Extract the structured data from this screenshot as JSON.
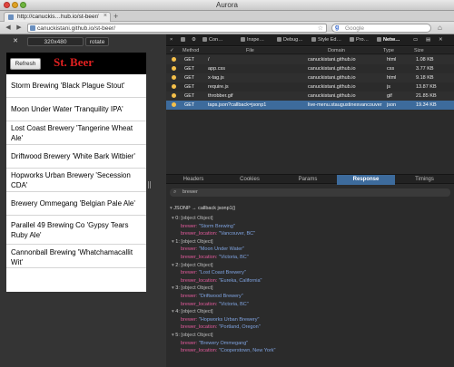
{
  "window": {
    "title": "Aurora"
  },
  "tabs": [
    {
      "label": "http://canuckis…hub.io/st-beer/"
    }
  ],
  "nav": {
    "url": "canuckistani.github.io/st-beer/",
    "search_placeholder": "Google"
  },
  "responsive": {
    "close": "✕",
    "size": "320x480",
    "rotate": "rotate"
  },
  "app": {
    "refresh_label": "Refresh",
    "title": "St. Beer",
    "beers": [
      "Storm Brewing 'Black Plague Stout'",
      "Moon Under Water 'Tranquility IPA'",
      "Lost Coast Brewery 'Tangerine Wheat Ale'",
      "Driftwood Brewery 'White Bark Witbier'",
      "Hopworks Urban Brewery 'Secession CDA'",
      "Brewery Ommegang 'Belgian Pale Ale'",
      "Parallel 49 Brewing Co 'Gypsy Tears Ruby Ale'",
      "Cannonball Brewing 'Whatchamacallit Wit'"
    ]
  },
  "devtools": {
    "tools": [
      "Con…",
      "Inspe…",
      "Debug…",
      "Style Ed…",
      "Pro…",
      "Netw…"
    ],
    "columns": {
      "method": "Method",
      "file": "File",
      "domain": "Domain",
      "type": "Type",
      "size": "Size"
    },
    "requests": [
      {
        "method": "GET",
        "file": "/",
        "domain": "canuckistani.github.io",
        "type": "html",
        "size": "1.08 KB"
      },
      {
        "method": "GET",
        "file": "app.css",
        "domain": "canuckistani.github.io",
        "type": "css",
        "size": "3.77 KB"
      },
      {
        "method": "GET",
        "file": "x-tag.js",
        "domain": "canuckistani.github.io",
        "type": "html",
        "size": "9.18 KB"
      },
      {
        "method": "GET",
        "file": "require.js",
        "domain": "canuckistani.github.io",
        "type": "js",
        "size": "13.87 KB"
      },
      {
        "method": "GET",
        "file": "throbber.gif",
        "domain": "canuckistani.github.io",
        "type": "gif",
        "size": "21.85 KB"
      },
      {
        "method": "GET",
        "file": "taps.json?callback=jsonp1",
        "domain": "live-menu.staugustinesvancouver…",
        "type": "json",
        "size": "19.34 KB"
      }
    ],
    "detail_tabs": [
      "Headers",
      "Cookies",
      "Params",
      "Response",
      "Timings"
    ],
    "active_detail_tab": "Response",
    "filter_value": "brewer",
    "json_header": "JSONP → callback jsonp1()",
    "json_rows": [
      {
        "kind": "obj",
        "index": "0:",
        "label": "[object Object]"
      },
      {
        "kind": "prop",
        "key": "brewer:",
        "value": "\"Storm Brewing\""
      },
      {
        "kind": "prop",
        "key": "brewer_location:",
        "value": "\"Vancouver, BC\""
      },
      {
        "kind": "obj",
        "index": "1:",
        "label": "[object Object]"
      },
      {
        "kind": "prop",
        "key": "brewer:",
        "value": "\"Moon Under Water\""
      },
      {
        "kind": "prop",
        "key": "brewer_location:",
        "value": "\"Victoria, BC\""
      },
      {
        "kind": "obj",
        "index": "2:",
        "label": "[object Object]"
      },
      {
        "kind": "prop",
        "key": "brewer:",
        "value": "\"Lost Coast Brewery\""
      },
      {
        "kind": "prop",
        "key": "brewer_location:",
        "value": "\"Eureka, California\""
      },
      {
        "kind": "obj",
        "index": "3:",
        "label": "[object Object]"
      },
      {
        "kind": "prop",
        "key": "brewer:",
        "value": "\"Driftwood Brewery\""
      },
      {
        "kind": "prop",
        "key": "brewer_location:",
        "value": "\"Victoria, BC\""
      },
      {
        "kind": "obj",
        "index": "4:",
        "label": "[object Object]"
      },
      {
        "kind": "prop",
        "key": "brewer:",
        "value": "\"Hopworks Urban Brewery\""
      },
      {
        "kind": "prop",
        "key": "brewer_location:",
        "value": "\"Portland, Oregon\""
      },
      {
        "kind": "obj",
        "index": "5:",
        "label": "[object Object]"
      },
      {
        "kind": "prop",
        "key": "brewer:",
        "value": "\"Brewery Ommegang\""
      },
      {
        "kind": "prop",
        "key": "brewer_location:",
        "value": "\"Cooperstown, New York\""
      }
    ]
  }
}
